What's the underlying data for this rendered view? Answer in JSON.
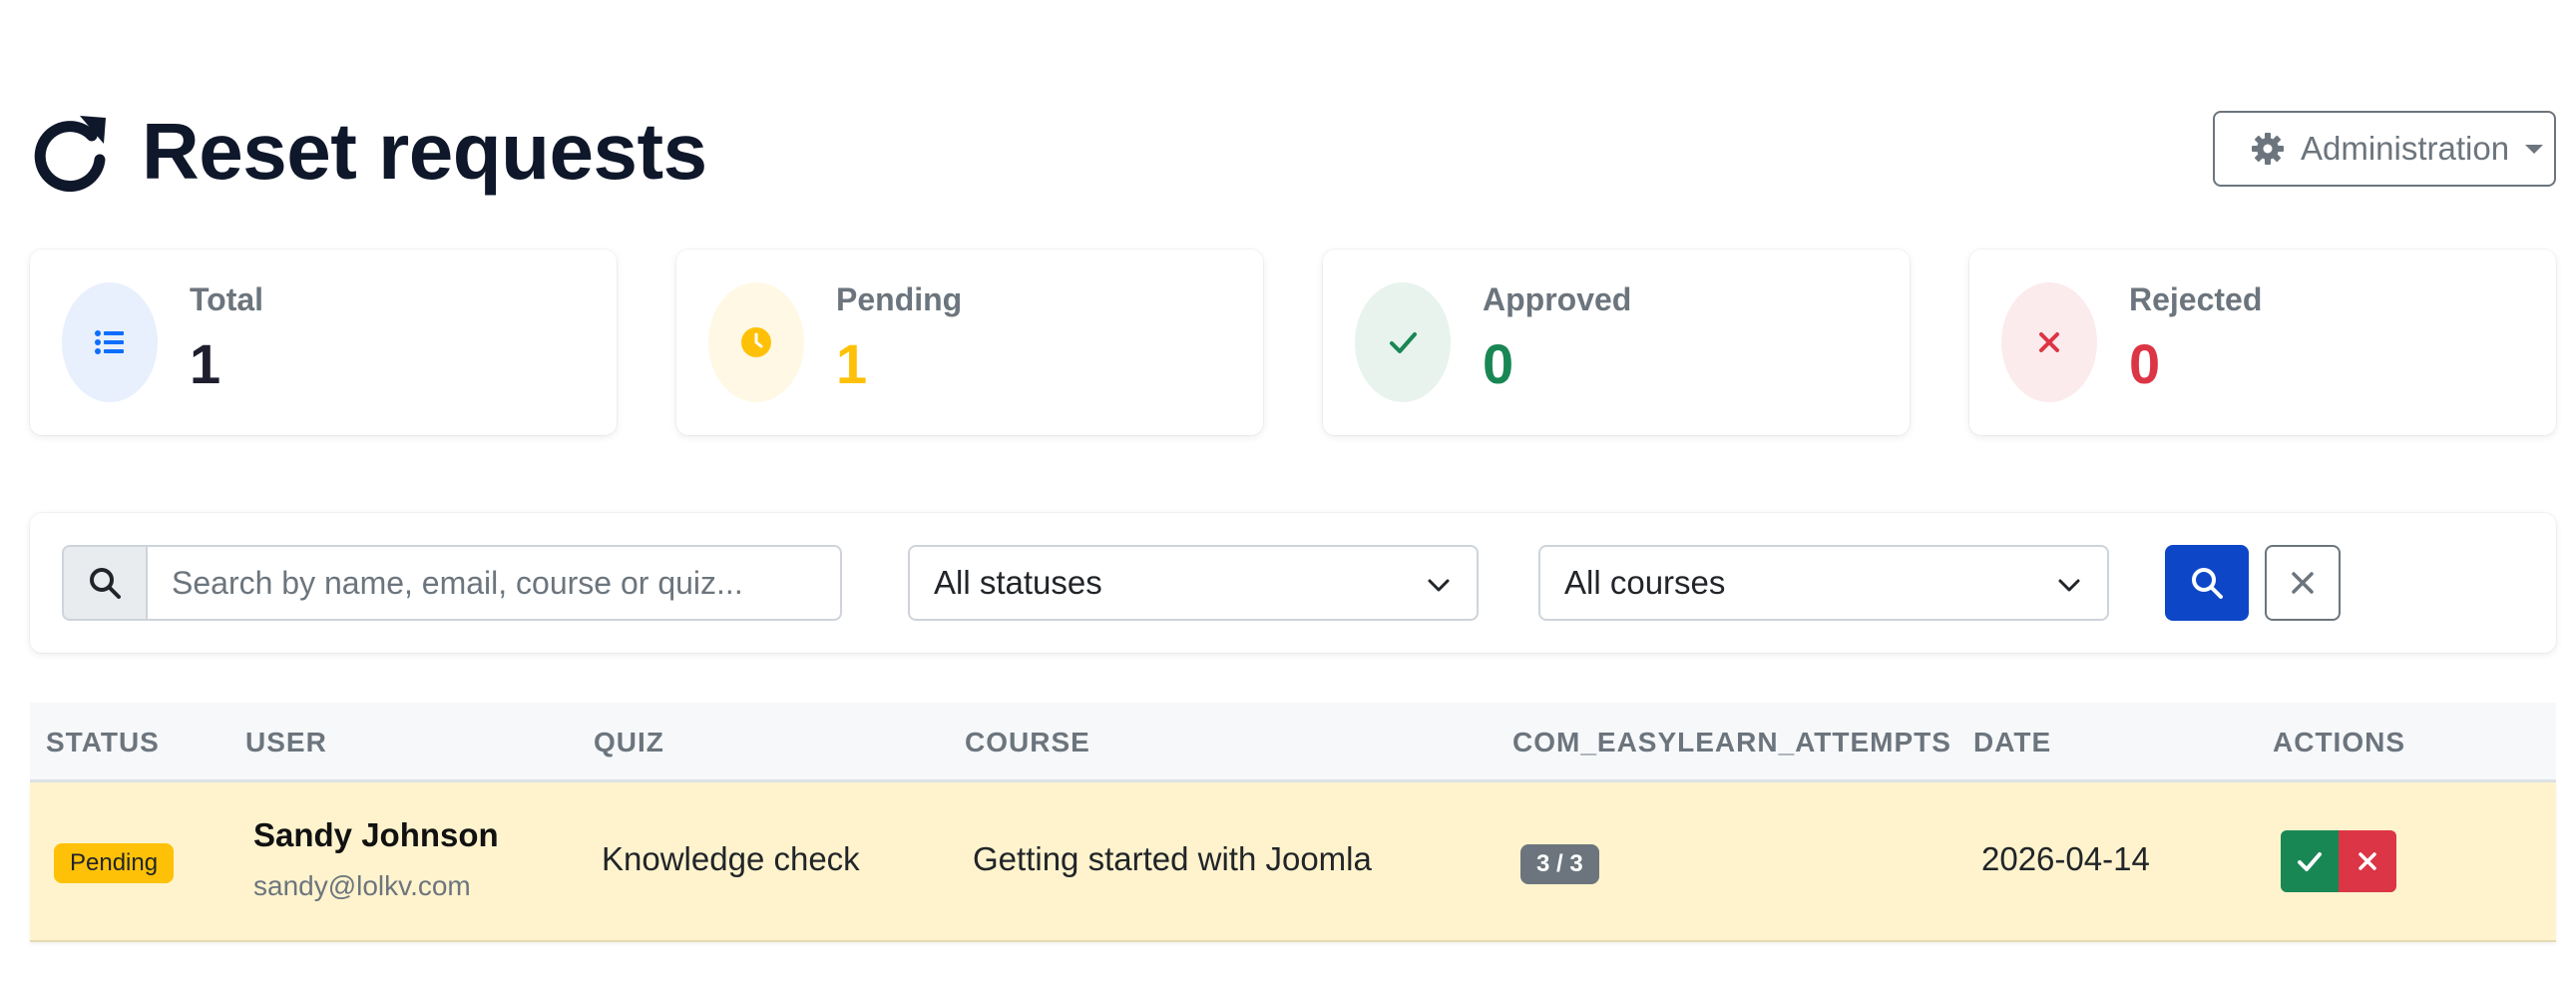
{
  "header": {
    "title": "Reset requests",
    "title_icon": "refresh-icon",
    "admin_button": {
      "label": "Administration",
      "icon": "gear-icon"
    }
  },
  "stats": [
    {
      "label": "Total",
      "value": "1",
      "icon": "list-icon",
      "color": "#1e1e2e",
      "accent": "#0d6efd",
      "bg": "#e8effd"
    },
    {
      "label": "Pending",
      "value": "1",
      "icon": "clock-icon",
      "color": "#ffc107",
      "accent": "#ffc107",
      "bg": "#fff8e5"
    },
    {
      "label": "Approved",
      "value": "0",
      "icon": "check-icon",
      "color": "#198754",
      "accent": "#198754",
      "bg": "#e8f3ed"
    },
    {
      "label": "Rejected",
      "value": "0",
      "icon": "x-icon",
      "color": "#dc3545",
      "accent": "#dc3545",
      "bg": "#fcebec"
    }
  ],
  "filters": {
    "search_placeholder": "Search by name, email, course or quiz...",
    "search_value": "",
    "status_select": "All statuses",
    "course_select": "All courses"
  },
  "table": {
    "columns": [
      "STATUS",
      "USER",
      "QUIZ",
      "COURSE",
      "COM_EASYLEARN_ATTEMPTS",
      "DATE",
      "ACTIONS"
    ],
    "rows": [
      {
        "status": "Pending",
        "user_name": "Sandy Johnson",
        "user_email": "sandy@lolkv.com",
        "quiz": "Knowledge check",
        "course": "Getting started with Joomla",
        "attempts": "3 / 3",
        "date": "2026-04-14"
      }
    ]
  },
  "colors": {
    "primary": "#0d47c8",
    "row_highlight": "#fff3cd",
    "muted": "#6c757d"
  }
}
